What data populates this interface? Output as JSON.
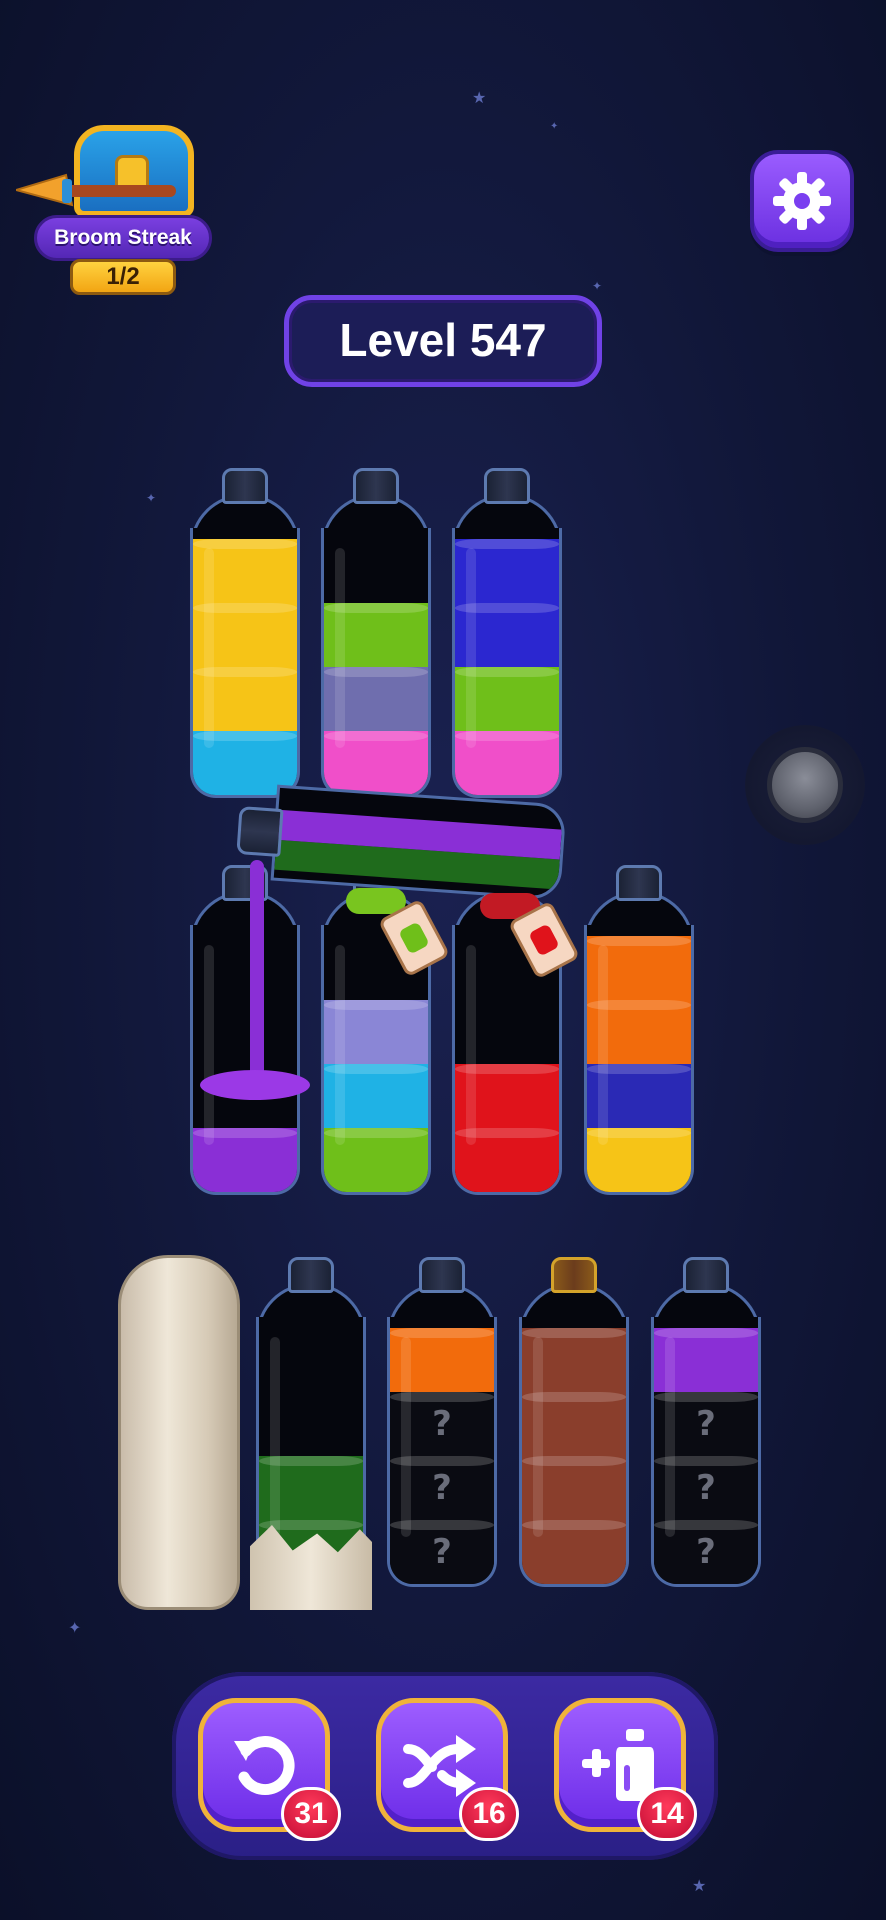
{
  "streak": {
    "label": "Broom Streak",
    "count": "1/2"
  },
  "level": {
    "label": "Level 547"
  },
  "icons": {
    "settings": "gear-icon",
    "undo": "undo-icon",
    "shuffle": "shuffle-icon",
    "add_bottle": "add-bottle-icon"
  },
  "colors": {
    "yellow": "#f6c417",
    "cyan": "#1fb2e5",
    "green": "#6fbf1a",
    "slate": "#6f6eae",
    "pink": "#f04fc9",
    "blue": "#2b27d0",
    "purple": "#8a2fd6",
    "dark_green": "#1f6b1c",
    "lavender": "#8a86d6",
    "red": "#e0131b",
    "orange": "#f26b0c",
    "navy": "#2a29b5",
    "brown": "#8a3e2c",
    "hidden": "#0a0b12"
  },
  "bottles": {
    "row1": [
      {
        "layers": [
          "cyan",
          "yellow",
          "yellow",
          "yellow"
        ]
      },
      {
        "layers": [
          "pink",
          "slate",
          "green"
        ]
      },
      {
        "layers": [
          "pink",
          "green",
          "blue",
          "blue"
        ]
      }
    ],
    "tilted": {
      "layers": [
        "dark_green",
        "purple"
      ]
    },
    "row2": [
      {
        "layers": [
          "purple"
        ]
      },
      {
        "layers": [
          "green",
          "cyan",
          "lavender"
        ]
      },
      {
        "layers": [
          "red",
          "red"
        ]
      },
      {
        "layers": [
          "yellow",
          "navy",
          "orange",
          "orange"
        ]
      }
    ],
    "row3": [
      {
        "state": "stone"
      },
      {
        "layers": [
          "dark_green",
          "dark_green"
        ]
      },
      {
        "layers": [
          "hidden",
          "hidden",
          "hidden",
          "orange"
        ],
        "hidden_mark": "?"
      },
      {
        "layers": [
          "brown",
          "brown",
          "brown",
          "brown"
        ],
        "corked": true
      },
      {
        "layers": [
          "hidden",
          "hidden",
          "hidden",
          "purple"
        ],
        "hidden_mark": "?"
      }
    ]
  },
  "tools": {
    "undo_count": "31",
    "shuffle_count": "16",
    "add_bottle_count": "14"
  }
}
